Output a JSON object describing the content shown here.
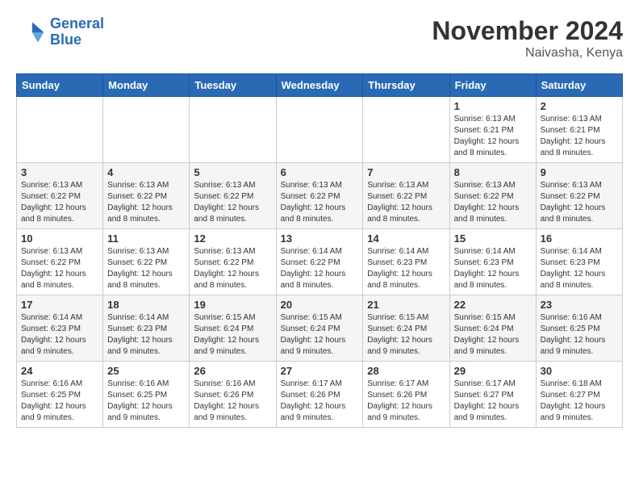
{
  "logo": {
    "line1": "General",
    "line2": "Blue"
  },
  "title": {
    "month": "November 2024",
    "location": "Naivasha, Kenya"
  },
  "weekdays": [
    "Sunday",
    "Monday",
    "Tuesday",
    "Wednesday",
    "Thursday",
    "Friday",
    "Saturday"
  ],
  "weeks": [
    [
      {
        "day": "",
        "info": ""
      },
      {
        "day": "",
        "info": ""
      },
      {
        "day": "",
        "info": ""
      },
      {
        "day": "",
        "info": ""
      },
      {
        "day": "",
        "info": ""
      },
      {
        "day": "1",
        "info": "Sunrise: 6:13 AM\nSunset: 6:21 PM\nDaylight: 12 hours and 8 minutes."
      },
      {
        "day": "2",
        "info": "Sunrise: 6:13 AM\nSunset: 6:21 PM\nDaylight: 12 hours and 8 minutes."
      }
    ],
    [
      {
        "day": "3",
        "info": "Sunrise: 6:13 AM\nSunset: 6:22 PM\nDaylight: 12 hours and 8 minutes."
      },
      {
        "day": "4",
        "info": "Sunrise: 6:13 AM\nSunset: 6:22 PM\nDaylight: 12 hours and 8 minutes."
      },
      {
        "day": "5",
        "info": "Sunrise: 6:13 AM\nSunset: 6:22 PM\nDaylight: 12 hours and 8 minutes."
      },
      {
        "day": "6",
        "info": "Sunrise: 6:13 AM\nSunset: 6:22 PM\nDaylight: 12 hours and 8 minutes."
      },
      {
        "day": "7",
        "info": "Sunrise: 6:13 AM\nSunset: 6:22 PM\nDaylight: 12 hours and 8 minutes."
      },
      {
        "day": "8",
        "info": "Sunrise: 6:13 AM\nSunset: 6:22 PM\nDaylight: 12 hours and 8 minutes."
      },
      {
        "day": "9",
        "info": "Sunrise: 6:13 AM\nSunset: 6:22 PM\nDaylight: 12 hours and 8 minutes."
      }
    ],
    [
      {
        "day": "10",
        "info": "Sunrise: 6:13 AM\nSunset: 6:22 PM\nDaylight: 12 hours and 8 minutes."
      },
      {
        "day": "11",
        "info": "Sunrise: 6:13 AM\nSunset: 6:22 PM\nDaylight: 12 hours and 8 minutes."
      },
      {
        "day": "12",
        "info": "Sunrise: 6:13 AM\nSunset: 6:22 PM\nDaylight: 12 hours and 8 minutes."
      },
      {
        "day": "13",
        "info": "Sunrise: 6:14 AM\nSunset: 6:22 PM\nDaylight: 12 hours and 8 minutes."
      },
      {
        "day": "14",
        "info": "Sunrise: 6:14 AM\nSunset: 6:23 PM\nDaylight: 12 hours and 8 minutes."
      },
      {
        "day": "15",
        "info": "Sunrise: 6:14 AM\nSunset: 6:23 PM\nDaylight: 12 hours and 8 minutes."
      },
      {
        "day": "16",
        "info": "Sunrise: 6:14 AM\nSunset: 6:23 PM\nDaylight: 12 hours and 8 minutes."
      }
    ],
    [
      {
        "day": "17",
        "info": "Sunrise: 6:14 AM\nSunset: 6:23 PM\nDaylight: 12 hours and 9 minutes."
      },
      {
        "day": "18",
        "info": "Sunrise: 6:14 AM\nSunset: 6:23 PM\nDaylight: 12 hours and 9 minutes."
      },
      {
        "day": "19",
        "info": "Sunrise: 6:15 AM\nSunset: 6:24 PM\nDaylight: 12 hours and 9 minutes."
      },
      {
        "day": "20",
        "info": "Sunrise: 6:15 AM\nSunset: 6:24 PM\nDaylight: 12 hours and 9 minutes."
      },
      {
        "day": "21",
        "info": "Sunrise: 6:15 AM\nSunset: 6:24 PM\nDaylight: 12 hours and 9 minutes."
      },
      {
        "day": "22",
        "info": "Sunrise: 6:15 AM\nSunset: 6:24 PM\nDaylight: 12 hours and 9 minutes."
      },
      {
        "day": "23",
        "info": "Sunrise: 6:16 AM\nSunset: 6:25 PM\nDaylight: 12 hours and 9 minutes."
      }
    ],
    [
      {
        "day": "24",
        "info": "Sunrise: 6:16 AM\nSunset: 6:25 PM\nDaylight: 12 hours and 9 minutes."
      },
      {
        "day": "25",
        "info": "Sunrise: 6:16 AM\nSunset: 6:25 PM\nDaylight: 12 hours and 9 minutes."
      },
      {
        "day": "26",
        "info": "Sunrise: 6:16 AM\nSunset: 6:26 PM\nDaylight: 12 hours and 9 minutes."
      },
      {
        "day": "27",
        "info": "Sunrise: 6:17 AM\nSunset: 6:26 PM\nDaylight: 12 hours and 9 minutes."
      },
      {
        "day": "28",
        "info": "Sunrise: 6:17 AM\nSunset: 6:26 PM\nDaylight: 12 hours and 9 minutes."
      },
      {
        "day": "29",
        "info": "Sunrise: 6:17 AM\nSunset: 6:27 PM\nDaylight: 12 hours and 9 minutes."
      },
      {
        "day": "30",
        "info": "Sunrise: 6:18 AM\nSunset: 6:27 PM\nDaylight: 12 hours and 9 minutes."
      }
    ]
  ]
}
